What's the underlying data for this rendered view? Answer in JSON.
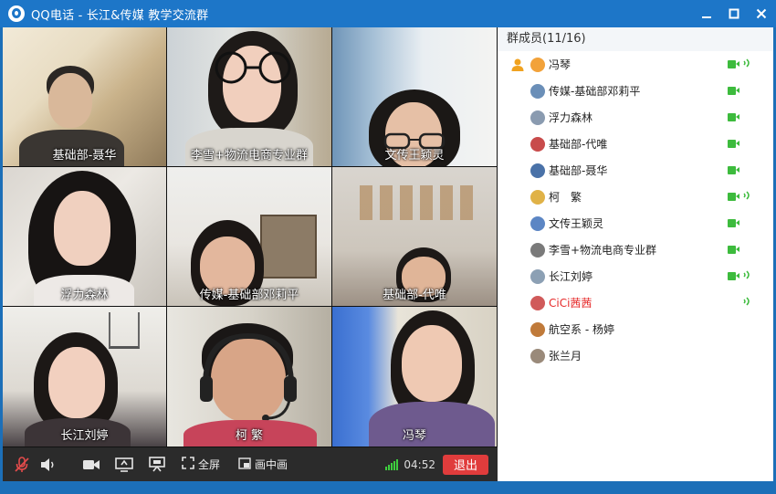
{
  "window": {
    "title": "QQ电话 - 长江&传媒 教学交流群",
    "controls": [
      "minimize-icon",
      "maximize-icon",
      "close-icon"
    ]
  },
  "video_tiles": [
    {
      "name": "基础部-聂华"
    },
    {
      "name": "李雪+物流电商专业群"
    },
    {
      "name": "文传王颖灵"
    },
    {
      "name": "浮力森林"
    },
    {
      "name": "传媒-基础部邓莉平"
    },
    {
      "name": "基础部-代唯"
    },
    {
      "name": "长江刘婷"
    },
    {
      "name": "柯 繁"
    },
    {
      "name": "冯琴"
    }
  ],
  "toolbar": {
    "mic_icon": "mic-muted-icon",
    "speaker_icon": "speaker-icon",
    "camera_icon": "camera-icon",
    "screen_share_icon": "screen-share-icon",
    "presentation_icon": "presentation-icon",
    "fullscreen_label": "全屏",
    "pip_label": "画中画",
    "duration": "04:52",
    "exit_label": "退出"
  },
  "members": {
    "header": "群成员(11/16)",
    "list": [
      {
        "name": "冯琴",
        "camera": true,
        "speaking": true,
        "red": false,
        "host": true
      },
      {
        "name": "传媒-基础部邓莉平",
        "camera": true,
        "speaking": false,
        "red": false
      },
      {
        "name": "浮力森林",
        "camera": true,
        "speaking": false,
        "red": false
      },
      {
        "name": "基础部-代唯",
        "camera": true,
        "speaking": false,
        "red": false
      },
      {
        "name": "基础部-聂华",
        "camera": true,
        "speaking": false,
        "red": false
      },
      {
        "name": "柯　繁",
        "camera": true,
        "speaking": true,
        "red": false
      },
      {
        "name": "文传王颖灵",
        "camera": true,
        "speaking": false,
        "red": false
      },
      {
        "name": "李雪+物流电商专业群",
        "camera": true,
        "speaking": false,
        "red": false
      },
      {
        "name": "长江刘婷",
        "camera": true,
        "speaking": true,
        "red": false
      },
      {
        "name": "CiCi茜茜",
        "camera": false,
        "speaking": true,
        "red": true
      },
      {
        "name": "航空系 - 杨婷",
        "camera": false,
        "speaking": false,
        "red": false
      },
      {
        "name": "张兰月",
        "camera": false,
        "speaking": false,
        "red": false
      }
    ]
  },
  "colors": {
    "titlebar": "#1d76c8",
    "exit": "#e03c3c",
    "status_green": "#3dbb3d",
    "highlight_name": "#e62828"
  }
}
